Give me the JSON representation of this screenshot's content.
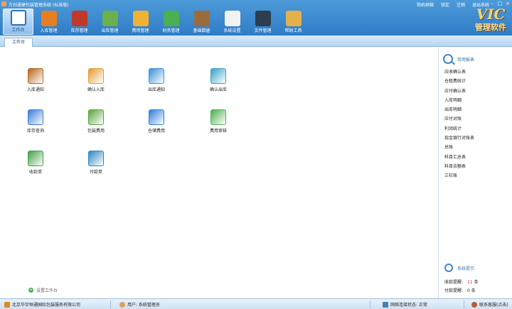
{
  "window": {
    "title": "方创通捷包装管理系统 (标准版)",
    "links": [
      "购机邮箱",
      "锁定",
      "注销",
      "退出系统"
    ],
    "controls": [
      "–",
      "□",
      "×"
    ]
  },
  "brand": {
    "logo": "VIC",
    "sub": "管理软件"
  },
  "toolbar": [
    {
      "label": "工作台",
      "icon": "desk-icon",
      "color": "#ffffff",
      "active": true
    },
    {
      "label": "入库管理",
      "icon": "box-in-icon",
      "color": "#e67e22"
    },
    {
      "label": "库存管理",
      "icon": "house-icon",
      "color": "#c0392b"
    },
    {
      "label": "出库管理",
      "icon": "box-out-icon",
      "color": "#6ab04c"
    },
    {
      "label": "费用管理",
      "icon": "bill-icon",
      "color": "#f0b232"
    },
    {
      "label": "财务管理",
      "icon": "money-icon",
      "color": "#4caf50"
    },
    {
      "label": "基础数据",
      "icon": "cabinet-icon",
      "color": "#9c6b3c"
    },
    {
      "label": "系统设置",
      "icon": "gear-icon",
      "color": "#f2f2f2"
    },
    {
      "label": "文件管理",
      "icon": "phone-icon",
      "color": "#2c3e50"
    },
    {
      "label": "帮助工具",
      "icon": "tools-icon",
      "color": "#e4b04a"
    }
  ],
  "tabs": {
    "current": "工作台"
  },
  "workbench": {
    "items": [
      {
        "label": "入库通知",
        "icon": "inbound-notice-icon",
        "color": "#b5651d"
      },
      {
        "label": "确认入库",
        "icon": "confirm-inbound-icon",
        "color": "#e39b34"
      },
      {
        "label": "出库通知",
        "icon": "outbound-notice-icon",
        "color": "#3a8fd6"
      },
      {
        "label": "确认出库",
        "icon": "confirm-outbound-icon",
        "color": "#3aa0c9"
      },
      {
        "label": "库存查询",
        "icon": "stock-query-icon",
        "color": "#3a7bd5"
      },
      {
        "label": "包装费用",
        "icon": "packing-fee-icon",
        "color": "#5aa33c"
      },
      {
        "label": "仓储费用",
        "icon": "storage-fee-icon",
        "color": "#2d7ed8"
      },
      {
        "label": "费用审核",
        "icon": "fee-audit-icon",
        "color": "#4caf50"
      },
      {
        "label": "收款单",
        "icon": "receipt-icon",
        "color": "#43a047"
      },
      {
        "label": "付款单",
        "icon": "payment-icon",
        "color": "#2e86c1"
      }
    ],
    "setup_label": "设置工作台"
  },
  "reports": {
    "title": "常用报表",
    "items": [
      "应收确认表",
      "仓租费统计",
      "应付确认表",
      "入库明细",
      "出库明细",
      "应付对账",
      "利润统计",
      "现金银行对账表",
      "总账",
      "科目汇总表",
      "科目余额表",
      "三栏账"
    ]
  },
  "system_tips": {
    "title": "系统提示",
    "rows": [
      {
        "label": "收款提醒:",
        "count": "11",
        "unit": "条"
      },
      {
        "label": "付款提醒:",
        "count": "0",
        "unit": "条"
      }
    ]
  },
  "status": {
    "company": "北京华宇恒通国际包装服务有限公司",
    "user": "用户: 系统管理员",
    "network": "网络连接状态: 正常",
    "contact": "联系客服(点击)"
  }
}
